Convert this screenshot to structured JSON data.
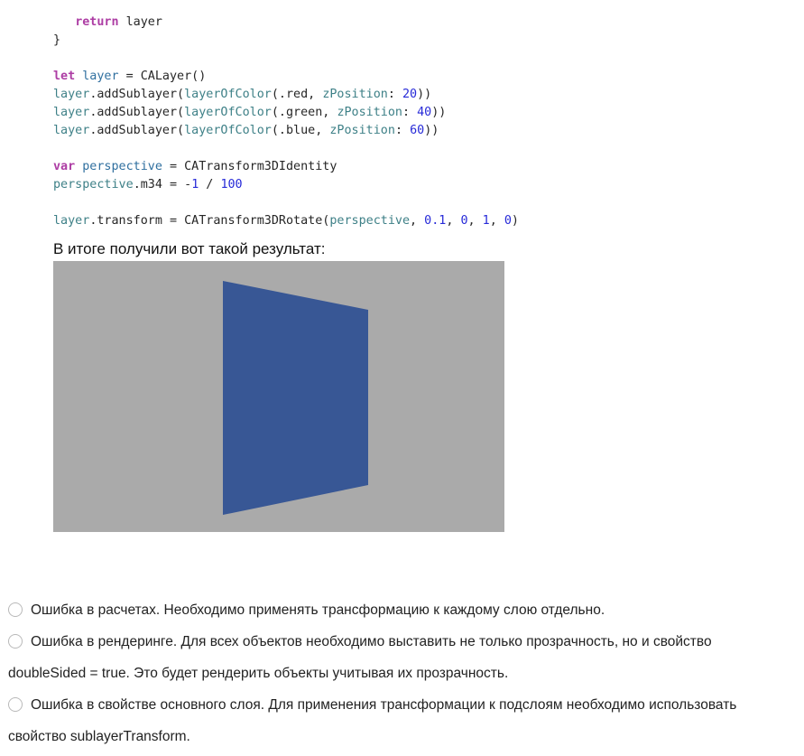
{
  "code": {
    "lines": [
      [
        {
          "t": "   ",
          "c": "plain"
        },
        {
          "t": "return",
          "c": "kw"
        },
        {
          "t": " layer",
          "c": "plain"
        }
      ],
      [
        {
          "t": "}",
          "c": "plain"
        }
      ],
      [],
      [
        {
          "t": "let",
          "c": "kw"
        },
        {
          "t": " ",
          "c": "plain"
        },
        {
          "t": "layer",
          "c": "decl"
        },
        {
          "t": " = CALayer()",
          "c": "plain"
        }
      ],
      [
        {
          "t": "layer",
          "c": "fn"
        },
        {
          "t": ".addSublayer(",
          "c": "plain"
        },
        {
          "t": "layerOfColor",
          "c": "fn"
        },
        {
          "t": "(.red, ",
          "c": "plain"
        },
        {
          "t": "zPosition",
          "c": "fn"
        },
        {
          "t": ": ",
          "c": "plain"
        },
        {
          "t": "20",
          "c": "num"
        },
        {
          "t": "))",
          "c": "plain"
        }
      ],
      [
        {
          "t": "layer",
          "c": "fn"
        },
        {
          "t": ".addSublayer(",
          "c": "plain"
        },
        {
          "t": "layerOfColor",
          "c": "fn"
        },
        {
          "t": "(.green, ",
          "c": "plain"
        },
        {
          "t": "zPosition",
          "c": "fn"
        },
        {
          "t": ": ",
          "c": "plain"
        },
        {
          "t": "40",
          "c": "num"
        },
        {
          "t": "))",
          "c": "plain"
        }
      ],
      [
        {
          "t": "layer",
          "c": "fn"
        },
        {
          "t": ".addSublayer(",
          "c": "plain"
        },
        {
          "t": "layerOfColor",
          "c": "fn"
        },
        {
          "t": "(.blue, ",
          "c": "plain"
        },
        {
          "t": "zPosition",
          "c": "fn"
        },
        {
          "t": ": ",
          "c": "plain"
        },
        {
          "t": "60",
          "c": "num"
        },
        {
          "t": "))",
          "c": "plain"
        }
      ],
      [],
      [
        {
          "t": "var",
          "c": "kw"
        },
        {
          "t": " ",
          "c": "plain"
        },
        {
          "t": "perspective",
          "c": "decl"
        },
        {
          "t": " = CATransform3DIdentity",
          "c": "plain"
        }
      ],
      [
        {
          "t": "perspective",
          "c": "fn"
        },
        {
          "t": ".m34 = -",
          "c": "plain"
        },
        {
          "t": "1",
          "c": "num"
        },
        {
          "t": " / ",
          "c": "plain"
        },
        {
          "t": "100",
          "c": "num"
        }
      ],
      [],
      [
        {
          "t": "layer",
          "c": "fn"
        },
        {
          "t": ".transform = CATransform3DRotate(",
          "c": "plain"
        },
        {
          "t": "perspective",
          "c": "fn"
        },
        {
          "t": ", ",
          "c": "plain"
        },
        {
          "t": "0.1",
          "c": "num"
        },
        {
          "t": ", ",
          "c": "plain"
        },
        {
          "t": "0",
          "c": "num"
        },
        {
          "t": ", ",
          "c": "plain"
        },
        {
          "t": "1",
          "c": "num"
        },
        {
          "t": ", ",
          "c": "plain"
        },
        {
          "t": "0",
          "c": "num"
        },
        {
          "t": ")",
          "c": "plain"
        }
      ]
    ]
  },
  "result_caption": "В итоге получили вот такой результат:",
  "render": {
    "background_color": "#aaaaaa",
    "shape_color": "#385795"
  },
  "options": [
    {
      "lines": [
        "Ошибка в расчетах. Необходимо применять трансформацию к каждому слою отдельно."
      ]
    },
    {
      "lines": [
        "Ошибка в рендеринге. Для всех объектов необходимо выставить не только прозрачность, но и свойство",
        "doubleSided = true. Это будет рендерить объекты учитывая их прозрачность."
      ]
    },
    {
      "lines": [
        "Ошибка в свойстве основного слоя. Для применения трансформации к подслоям необходимо использовать",
        "свойство sublayerTransform."
      ]
    }
  ]
}
